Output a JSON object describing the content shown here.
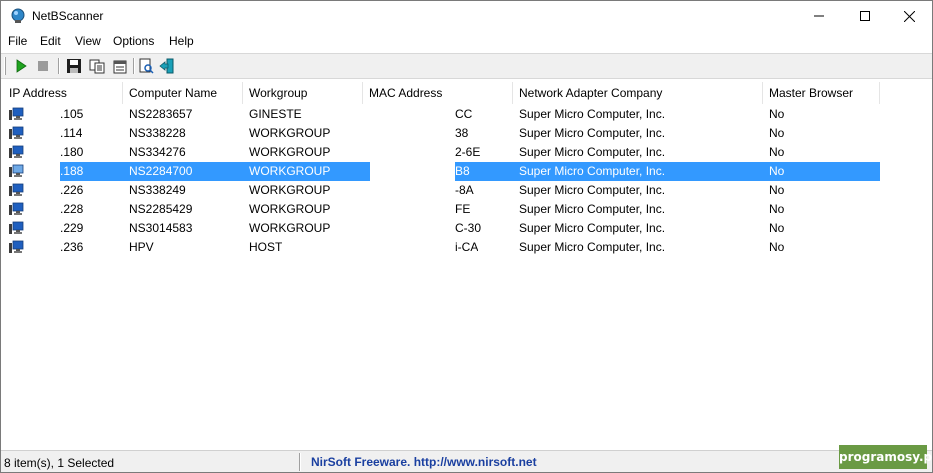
{
  "window": {
    "title": "NetBScanner"
  },
  "menu": [
    "File",
    "Edit",
    "View",
    "Options",
    "Help"
  ],
  "toolbar": {
    "buttons": [
      "start-scan",
      "stop-scan",
      "save",
      "copy",
      "properties",
      "html-report",
      "exit"
    ]
  },
  "columns": [
    "IP Address",
    "Computer Name",
    "Workgroup",
    "MAC Address",
    "Network Adapter Company",
    "Master Browser"
  ],
  "rows": [
    {
      "ip": ".105",
      "name": "NS2283657",
      "workgroup": "GINESTE",
      "mac": "CC",
      "company": "Super Micro Computer, Inc.",
      "master": "No",
      "selected": false
    },
    {
      "ip": ".114",
      "name": "NS338228",
      "workgroup": "WORKGROUP",
      "mac": "38",
      "company": "Super Micro Computer, Inc.",
      "master": "No",
      "selected": false
    },
    {
      "ip": ".180",
      "name": "NS334276",
      "workgroup": "WORKGROUP",
      "mac": "2-6E",
      "company": "Super Micro Computer, Inc.",
      "master": "No",
      "selected": false
    },
    {
      "ip": ".188",
      "name": "NS2284700",
      "workgroup": "WORKGROUP",
      "mac": "B8",
      "company": "Super Micro Computer, Inc.",
      "master": "No",
      "selected": true
    },
    {
      "ip": ".226",
      "name": "NS338249",
      "workgroup": "WORKGROUP",
      "mac": "-8A",
      "company": "Super Micro Computer, Inc.",
      "master": "No",
      "selected": false
    },
    {
      "ip": ".228",
      "name": "NS2285429",
      "workgroup": "WORKGROUP",
      "mac": "FE",
      "company": "Super Micro Computer, Inc.",
      "master": "No",
      "selected": false
    },
    {
      "ip": ".229",
      "name": "NS3014583",
      "workgroup": "WORKGROUP",
      "mac": "C-30",
      "company": "Super Micro Computer, Inc.",
      "master": "No",
      "selected": false
    },
    {
      "ip": ".236",
      "name": "HPV",
      "workgroup": "HOST",
      "mac": "i-CA",
      "company": "Super Micro Computer, Inc.",
      "master": "No",
      "selected": false
    }
  ],
  "status": {
    "count": "8 item(s), 1 Selected",
    "link": "NirSoft Freeware.  http://www.nirsoft.net"
  },
  "watermark": "programosy.pl",
  "colors": {
    "selection": "#3399ff",
    "link": "#1a3fa0",
    "play": "#1fa31f",
    "watermark_bg": "#6a9a44"
  }
}
